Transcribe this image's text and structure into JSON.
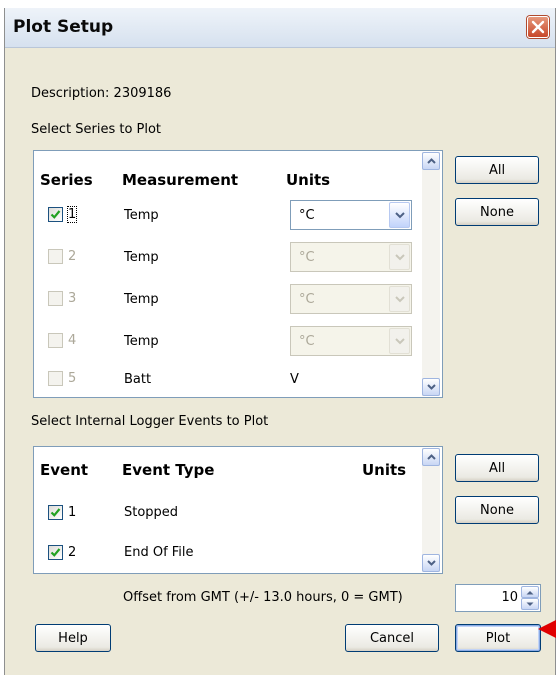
{
  "window": {
    "title": "Plot Setup"
  },
  "description": "Description: 2309186",
  "series_section": {
    "heading": "Select Series to Plot",
    "columns": {
      "series": "Series",
      "measurement": "Measurement",
      "units": "Units"
    },
    "rows": [
      {
        "num": "1",
        "measurement": "Temp",
        "units": "°C",
        "checked": true,
        "enabled": true,
        "unit_type": "combo"
      },
      {
        "num": "2",
        "measurement": "Temp",
        "units": "°C",
        "checked": false,
        "enabled": false,
        "unit_type": "combo"
      },
      {
        "num": "3",
        "measurement": "Temp",
        "units": "°C",
        "checked": false,
        "enabled": false,
        "unit_type": "combo"
      },
      {
        "num": "4",
        "measurement": "Temp",
        "units": "°C",
        "checked": false,
        "enabled": false,
        "unit_type": "combo"
      },
      {
        "num": "5",
        "measurement": "Batt",
        "units": "V",
        "checked": false,
        "enabled": false,
        "unit_type": "text"
      }
    ],
    "all_label": "All",
    "none_label": "None"
  },
  "events_section": {
    "heading": "Select Internal Logger Events to Plot",
    "columns": {
      "event": "Event",
      "event_type": "Event Type",
      "units": "Units"
    },
    "rows": [
      {
        "num": "1",
        "event_type": "Stopped",
        "checked": true
      },
      {
        "num": "2",
        "event_type": "End Of File",
        "checked": true
      }
    ],
    "all_label": "All",
    "none_label": "None"
  },
  "offset": {
    "label": "Offset from GMT (+/- 13.0 hours, 0 = GMT)",
    "value": "10"
  },
  "buttons": {
    "help": "Help",
    "cancel": "Cancel",
    "plot": "Plot"
  },
  "colors": {
    "checkmark": "#21a121",
    "pointer": "#e00000",
    "close": "#c8472a"
  }
}
